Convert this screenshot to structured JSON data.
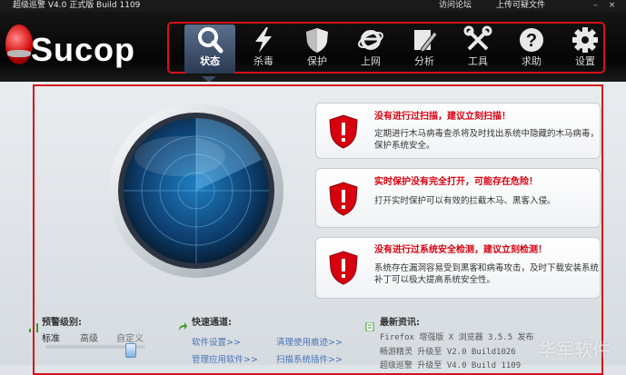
{
  "window": {
    "title": "超级巡警 V4.0 正式版 Build 1109",
    "links": [
      "访问论坛",
      "上传可疑文件"
    ],
    "controls": [
      "–",
      "×"
    ]
  },
  "app": {
    "brand": "Sucop"
  },
  "nav": {
    "items": [
      {
        "label": "状态",
        "icon": "magnifier-icon",
        "active": true
      },
      {
        "label": "杀毒",
        "icon": "lightning-icon",
        "active": false
      },
      {
        "label": "保护",
        "icon": "shield-icon",
        "active": false
      },
      {
        "label": "上网",
        "icon": "browser-e-icon",
        "active": false
      },
      {
        "label": "分析",
        "icon": "pen-icon",
        "active": false
      },
      {
        "label": "工具",
        "icon": "wrench-screwdriver-icon",
        "active": false
      },
      {
        "label": "求助",
        "icon": "question-icon",
        "active": false
      },
      {
        "label": "设置",
        "icon": "gear-icon",
        "active": false
      }
    ]
  },
  "alerts": [
    {
      "title": "没有进行过扫描，建议立刻扫描！",
      "body": "定期进行木马病毒查杀将及时找出系统中隐藏的木马病毒，保护系统安全。"
    },
    {
      "title": "实时保护没有完全打开，可能存在危险！",
      "body": "打开实时保护可以有效的拦截木马、黑客入侵。"
    },
    {
      "title": "没有进行过系统安全检测，建议立刻检测！",
      "body": "系统存在漏洞容易受到黑客和病毒攻击，及时下载安装系统补丁可以极大提高系统安全性。"
    }
  ],
  "warning_level": {
    "title": "预警级别:",
    "options": [
      "标准",
      "高级",
      "自定义"
    ],
    "selected": "标准"
  },
  "quick_access": {
    "title": "快速通道:",
    "links": [
      "软件设置>>",
      "清理使用痕迹>>",
      "管理应用软件>>",
      "扫描系统插件>>"
    ]
  },
  "news": {
    "title": "最新资讯:",
    "items": [
      "Firefox 增强版 X 浏览器 3.5.5 发布",
      "畅游精灵 升级至 V2.0 Build1026",
      "超级巡警 升级至 V4.0 Build 1109"
    ]
  },
  "watermark": "华军软件",
  "colors": {
    "accent_red": "#d8101a",
    "alert_text": "#d7000f",
    "link_blue": "#4a74b5",
    "header_bg": "#0a0a0a"
  }
}
